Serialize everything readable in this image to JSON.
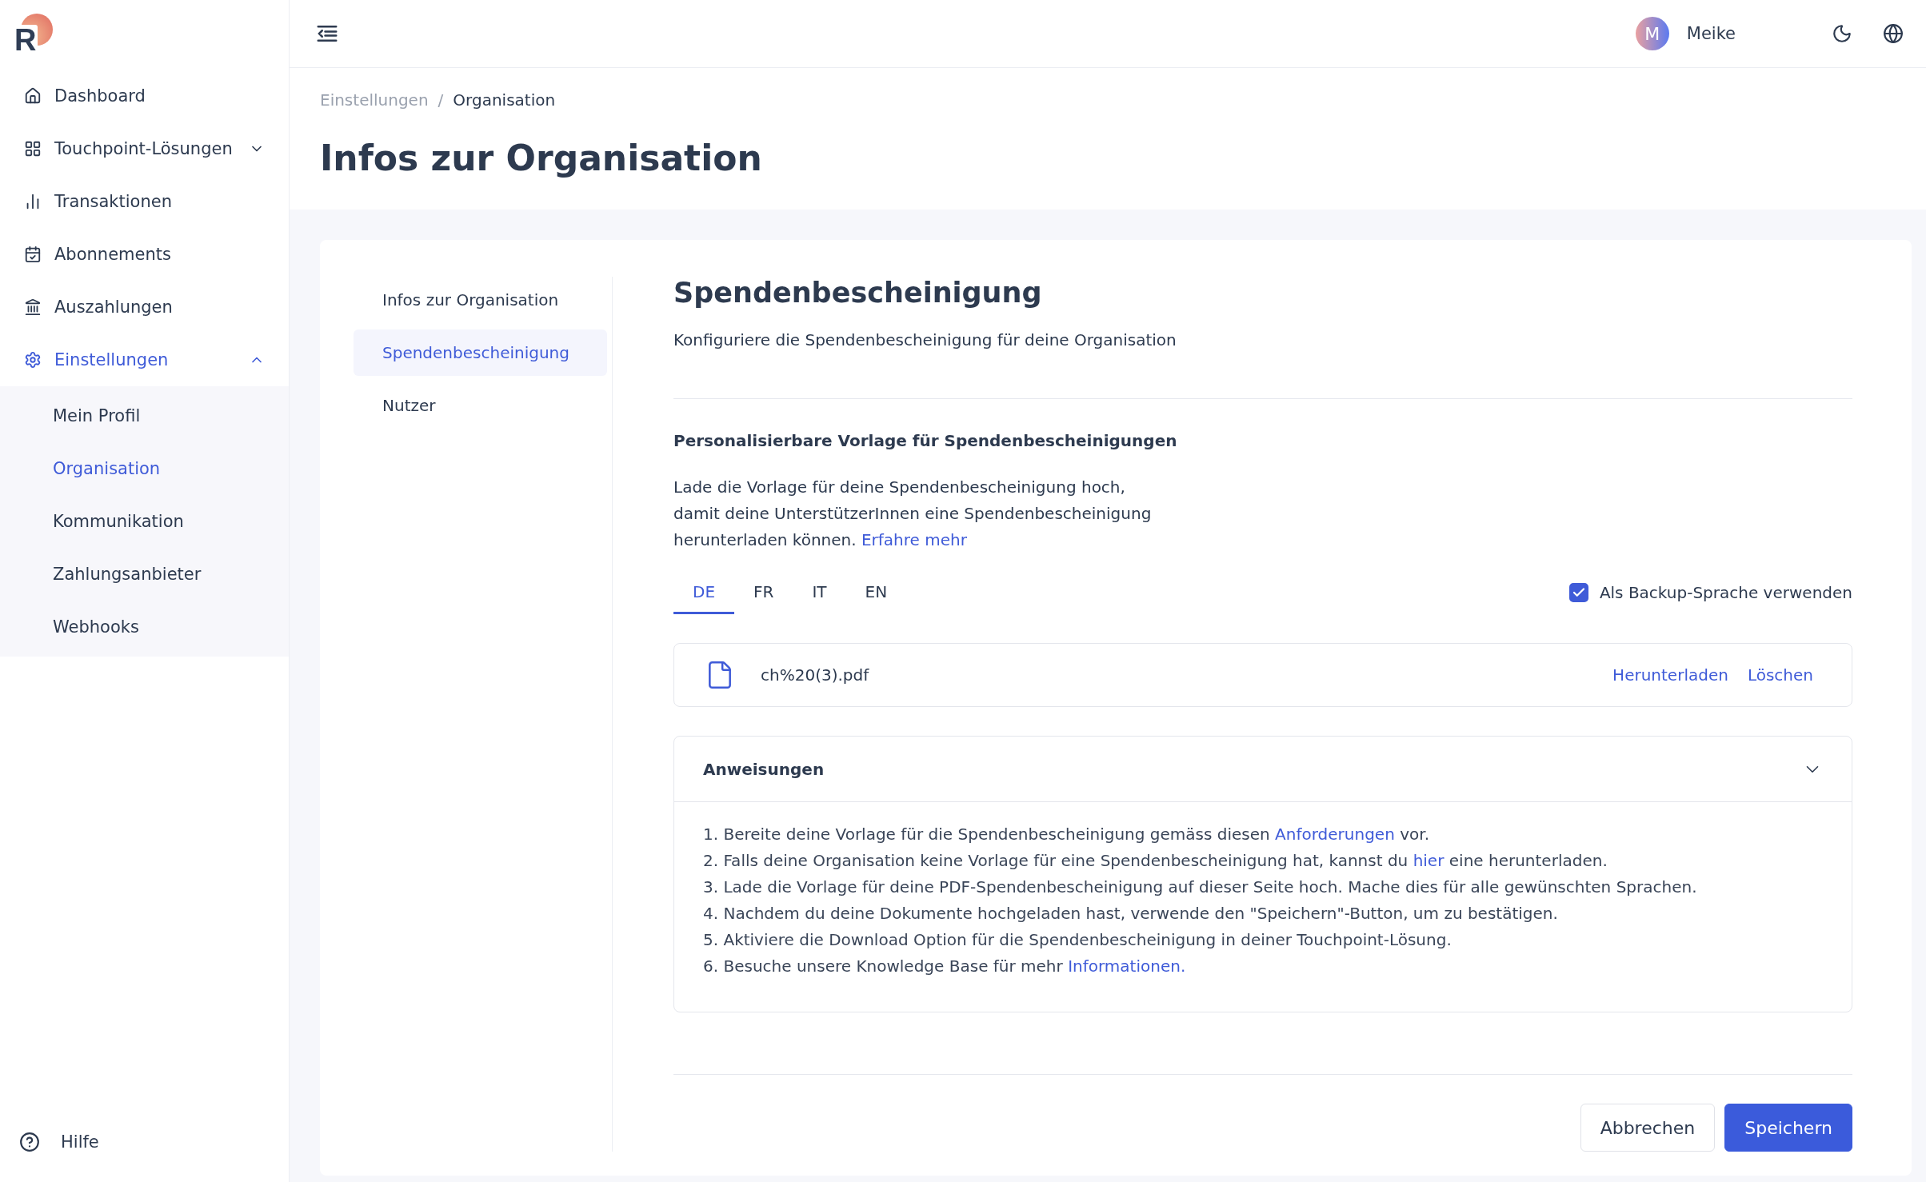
{
  "logo": {
    "letter": "R"
  },
  "sidebar": {
    "items": [
      {
        "label": "Dashboard",
        "selected": false
      },
      {
        "label": "Touchpoint-Lösungen",
        "selected": false,
        "expanded": false
      },
      {
        "label": "Transaktionen",
        "selected": false
      },
      {
        "label": "Abonnements",
        "selected": false
      },
      {
        "label": "Auszahlungen",
        "selected": false
      },
      {
        "label": "Einstellungen",
        "selected": true,
        "expanded": true,
        "children": [
          {
            "label": "Mein Profil",
            "selected": false
          },
          {
            "label": "Organisation",
            "selected": true
          },
          {
            "label": "Kommunikation",
            "selected": false
          },
          {
            "label": "Zahlungsanbieter",
            "selected": false
          },
          {
            "label": "Webhooks",
            "selected": false
          }
        ]
      }
    ],
    "help": "Hilfe"
  },
  "header": {
    "user": {
      "initial": "M",
      "name": "Meike"
    }
  },
  "breadcrumb": [
    "Einstellungen",
    "Organisation"
  ],
  "breadcrumb_separator": "/",
  "page_title": "Infos zur Organisation",
  "subnav": [
    {
      "label": "Infos zur Organisation",
      "selected": false
    },
    {
      "label": "Spendenbescheinigung",
      "selected": true
    },
    {
      "label": "Nutzer",
      "selected": false
    }
  ],
  "section": {
    "title": "Spendenbescheinigung",
    "subtitle": "Konfiguriere die Spendenbescheinigung für deine Organisation",
    "template_heading": "Personalisierbare Vorlage für Spendenbescheinigungen",
    "description": {
      "before": "Lade die Vorlage für deine Spendenbescheinigung hoch, damit deine UnterstützerInnen eine Spendenbescheinigung herunterladen können. ",
      "link": "Erfahre mehr"
    },
    "language_tabs": [
      {
        "label": "DE",
        "selected": true
      },
      {
        "label": "FR",
        "selected": false
      },
      {
        "label": "IT",
        "selected": false
      },
      {
        "label": "EN",
        "selected": false
      }
    ],
    "backup_language": {
      "label": "Als Backup-Sprache verwenden",
      "checked": true
    },
    "file": {
      "name": "ch%20(3).pdf",
      "actions": [
        "Herunterladen",
        "Löschen"
      ]
    },
    "instructions": {
      "title": "Anweisungen",
      "expanded": true,
      "steps": [
        {
          "number": "1.",
          "before": "Bereite deine Vorlage für die Spendenbescheinigung gemäss diesen ",
          "link": "Anforderungen",
          "after": " vor."
        },
        {
          "number": "2.",
          "before": "Falls deine Organisation keine Vorlage für eine Spendenbescheinigung hat, kannst du ",
          "link": "hier",
          "after": " eine herunterladen."
        },
        {
          "number": "3.",
          "before": "Lade die Vorlage für deine PDF-Spendenbescheinigung auf dieser Seite hoch. Mache dies für alle gewünschten Sprachen."
        },
        {
          "number": "4.",
          "before": "Nachdem du deine Dokumente hochgeladen hast, verwende den \"Speichern\"-Button, um zu bestätigen."
        },
        {
          "number": "5.",
          "before": "Aktiviere die Download Option für die Spendenbescheinigung in deiner Touchpoint-Lösung."
        },
        {
          "number": "6.",
          "before": "Besuche unsere Knowledge Base für mehr ",
          "link": "Informationen."
        }
      ]
    }
  },
  "buttons": {
    "cancel": "Abbrechen",
    "save": "Speichern"
  }
}
